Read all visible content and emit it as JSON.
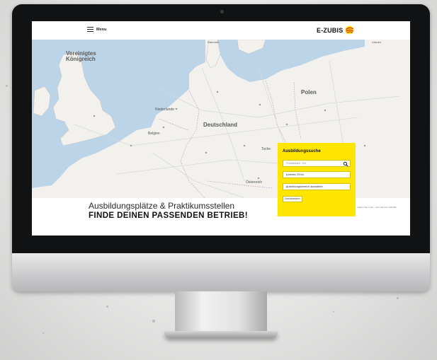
{
  "header": {
    "menu_label": "Menu",
    "logo_text": "E-ZUBIS"
  },
  "map": {
    "labels": [
      {
        "key": "uk",
        "text": "Vereinigtes\nKönigreich"
      },
      {
        "key": "dk",
        "text": "Danmark"
      },
      {
        "key": "lt",
        "text": "Litauen"
      },
      {
        "key": "pl",
        "text": "Polen"
      },
      {
        "key": "nl",
        "text": "Niederlande"
      },
      {
        "key": "de",
        "text": "Deutschland"
      },
      {
        "key": "be",
        "text": "Belgien"
      },
      {
        "key": "at",
        "text": "Österreich"
      },
      {
        "key": "cz",
        "text": "Tsche"
      }
    ],
    "attribution": "Leaflet | Tiles © Esri — Esri, DeLorme, NAVTEQ"
  },
  "hero": {
    "line1": "Ausbildungsplätze & Praktikumsstellen",
    "line2": "FINDE DEINEN PASSENDEN BETRIEB!"
  },
  "search_panel": {
    "title": "Ausbildungssuche",
    "location_placeholder": "Postleitzahl / Ort",
    "radius_value": "Umkreis 25 km",
    "area_value": "Ausbildungsbereich auswählen",
    "reset_label": "Zurücksetzen"
  },
  "colors": {
    "accent_yellow": "#ffe600",
    "logo_red": "#e5332a",
    "bezel": "#111214"
  }
}
